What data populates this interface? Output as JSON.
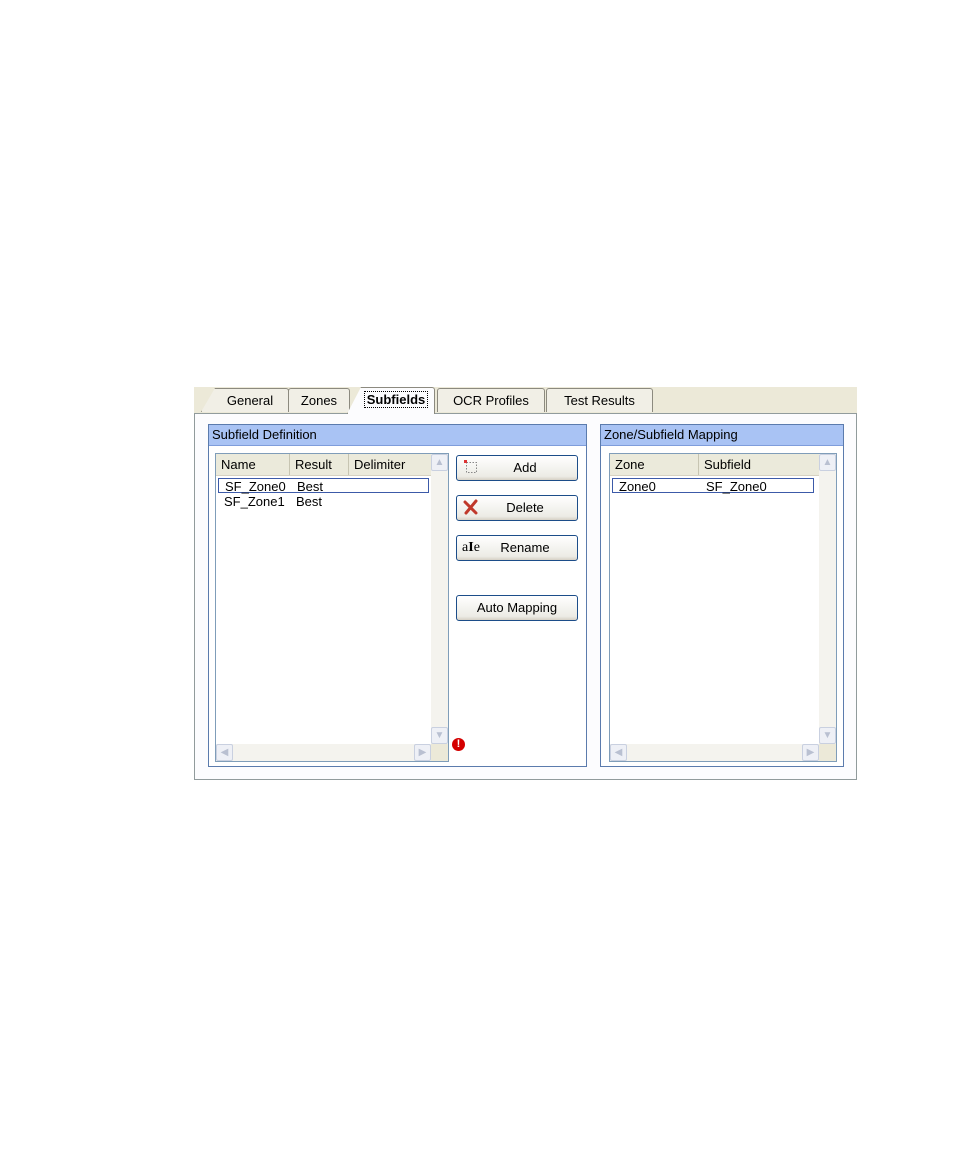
{
  "tabs": [
    {
      "label": "General",
      "active": false
    },
    {
      "label": "Zones",
      "active": false
    },
    {
      "label": "Subfields",
      "active": true
    },
    {
      "label": "OCR Profiles",
      "active": false
    },
    {
      "label": "Test Results",
      "active": false
    }
  ],
  "subfield_definition": {
    "title": "Subfield Definition",
    "columns": [
      "Name",
      "Result",
      "Delimiter"
    ],
    "rows": [
      {
        "name": "SF_Zone0",
        "result": "Best",
        "delimiter": "",
        "selected": true
      },
      {
        "name": "SF_Zone1",
        "result": "Best",
        "delimiter": "",
        "selected": false
      }
    ]
  },
  "buttons": {
    "add": "Add",
    "delete": "Delete",
    "rename": "Rename",
    "auto_mapping": "Auto Mapping"
  },
  "icons": {
    "add": "new-item-icon",
    "delete": "red-x-icon",
    "rename": "rename-text-cursor-icon",
    "warning": "error-exclamation-icon",
    "scroll_up": "chevron-up-icon",
    "scroll_down": "chevron-down-icon",
    "scroll_left": "chevron-left-icon",
    "scroll_right": "chevron-right-icon"
  },
  "zone_subfield_mapping": {
    "title": "Zone/Subfield Mapping",
    "columns": [
      "Zone",
      "Subfield"
    ],
    "rows": [
      {
        "zone": "Zone0",
        "subfield": "SF_Zone0",
        "selected": true
      }
    ]
  },
  "colors": {
    "group_header": "#a9c3f4",
    "warning": "#d40000",
    "delete_icon": "#c0392b"
  }
}
